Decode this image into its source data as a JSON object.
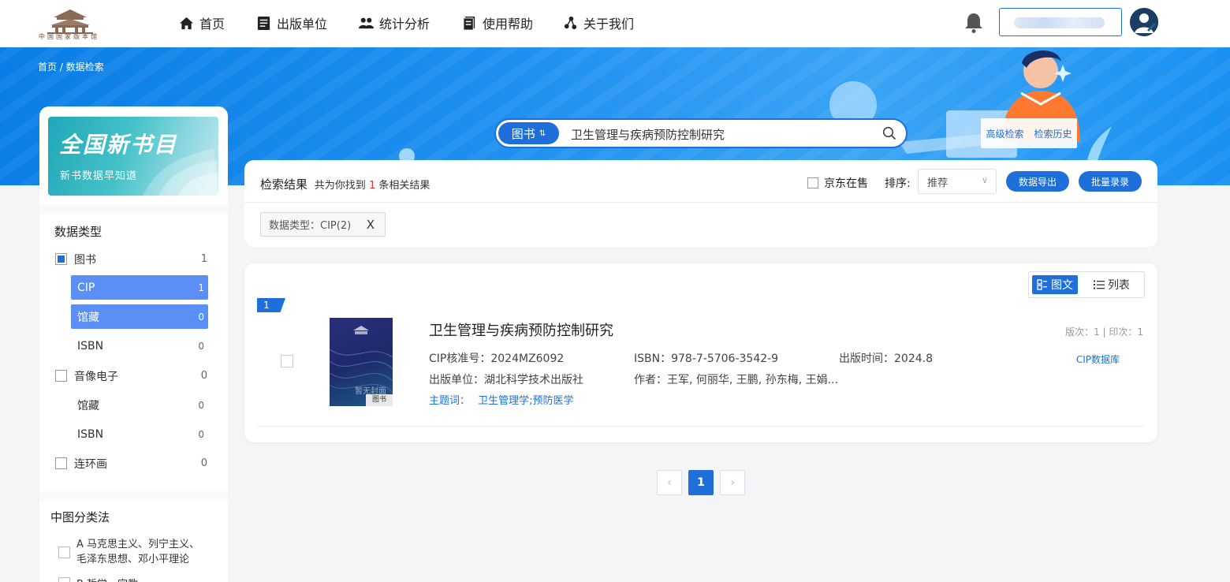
{
  "nav": {
    "items": [
      {
        "label": "首页",
        "icon": "home-icon"
      },
      {
        "label": "出版单位",
        "icon": "publisher-icon"
      },
      {
        "label": "统计分析",
        "icon": "users-icon"
      },
      {
        "label": "使用帮助",
        "icon": "help-icon"
      },
      {
        "label": "关于我们",
        "icon": "about-icon"
      }
    ],
    "logo_text": "中国国家版本馆"
  },
  "breadcrumb": "首页  /  数据检索",
  "search": {
    "type_label": "图书",
    "type_switch": "⇅",
    "query": "卫生管理与疾病预防控制研究",
    "advanced": "高级检索",
    "history": "检索历史"
  },
  "sidebar": {
    "promo_title": "全国新书目",
    "promo_subtitle": "新书数据早知道",
    "data_type_title": "数据类型",
    "data_types": [
      {
        "label": "图书",
        "count": "1"
      },
      {
        "label": "音像电子",
        "count": "0"
      },
      {
        "label": "连环画",
        "count": "0"
      }
    ],
    "book_subs": [
      {
        "label": "CIP",
        "count": "1"
      },
      {
        "label": "馆藏",
        "count": "0"
      },
      {
        "label": "ISBN",
        "count": "0"
      }
    ],
    "av_subs": [
      {
        "label": "馆藏",
        "count": "0"
      },
      {
        "label": "ISBN",
        "count": "0"
      }
    ],
    "classification_title": "中图分类法",
    "classification_items": [
      {
        "line1": "A 马克思主义、列宁主义、",
        "line2": "毛泽东思想、邓小平理论"
      },
      {
        "line1": "B 哲学、宗教",
        "line2": ""
      }
    ]
  },
  "results": {
    "heading": "检索结果",
    "found_prefix": "共为你找到",
    "found_count": "1",
    "found_suffix": "条相关结果",
    "jd_label": "京东在售",
    "sort_label": "排序:",
    "sort_value": "推荐",
    "export_label": "数据导出",
    "batch_label": "批量录录",
    "filter_tag": "数据类型：CIP(2)",
    "filter_close": "X"
  },
  "view": {
    "grid_label": "图文",
    "list_label": "列表"
  },
  "item": {
    "index": "1",
    "title": "卫生管理与疾病预防控制研究",
    "cip": "CIP核准号：2024MZ6092",
    "isbn": "ISBN：978-7-5706-3542-9",
    "pub_date": "出版时间：2024.8",
    "publisher": "出版单位：湖北科学技术出版社",
    "author": "作者：王军, 何丽华, 王鹏, 孙东梅, 王娟...",
    "subject_label": "主题词：",
    "subject": "卫生管理学;预防医学",
    "edition": "版次：1  |  印次：1",
    "source": "CIP数据库",
    "cover_label": "图书",
    "cover_placeholder": "暂无封面"
  },
  "pagination": {
    "prev": "‹",
    "current": "1",
    "next": "›"
  },
  "colors": {
    "brand": "#1e6fd9",
    "sub_active": "#5b8ff5",
    "count_highlight": "#ee3333"
  }
}
